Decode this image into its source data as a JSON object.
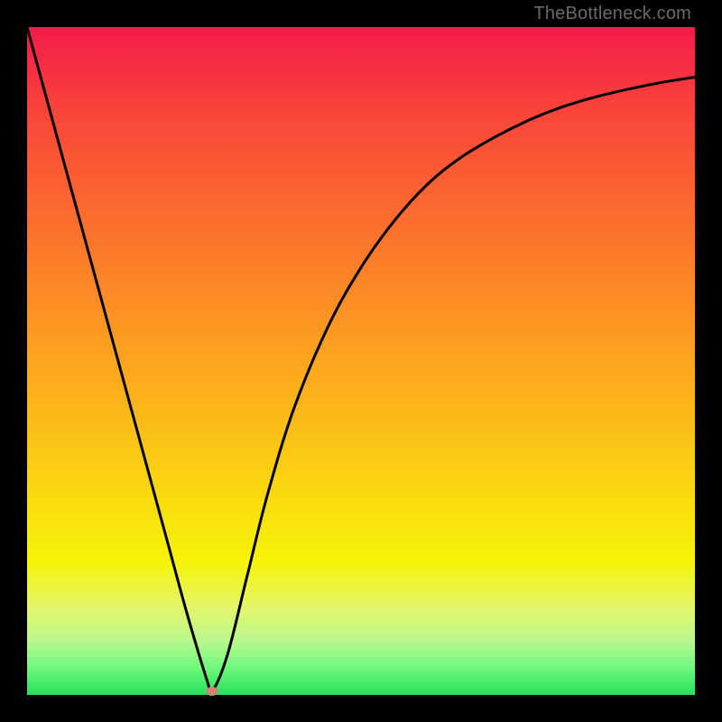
{
  "watermark": "TheBottleneck.com",
  "colors": {
    "page_bg": "#000000",
    "curve_stroke": "#000000",
    "marker_fill": "#cf8572",
    "gradient_stops": [
      "#f51a4a",
      "#f9423a",
      "#fb6b2e",
      "#fc9522",
      "#fbb917",
      "#f9d90e",
      "#f6f306",
      "#e3f56b",
      "#b7f78f",
      "#6ef97a",
      "#26e05a"
    ]
  },
  "chart_data": {
    "type": "line",
    "title": "",
    "xlabel": "",
    "ylabel": "",
    "xlim": [
      0,
      100
    ],
    "ylim": [
      0,
      100
    ],
    "x": [
      0,
      3,
      6,
      9,
      12,
      15,
      18,
      21,
      24,
      27,
      27.7,
      30,
      33,
      36,
      40,
      45,
      50,
      55,
      60,
      65,
      70,
      75,
      80,
      85,
      90,
      95,
      100
    ],
    "values": [
      100,
      89,
      78,
      67,
      56,
      45,
      34,
      23,
      12,
      2,
      0.5,
      6,
      18,
      30,
      43,
      55,
      64,
      71,
      76.5,
      80.5,
      83.5,
      86,
      88,
      89.5,
      90.7,
      91.7,
      92.5
    ],
    "marker": {
      "x": 27.7,
      "y": 0.5
    },
    "grid": false,
    "legend": false
  }
}
